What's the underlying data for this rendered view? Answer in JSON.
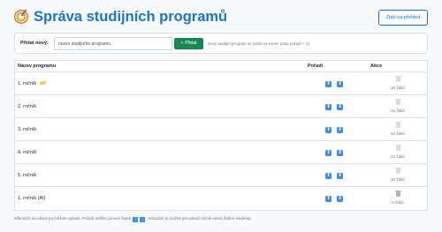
{
  "header": {
    "title": "Správa studijních programů",
    "back_label": "Zpět na přehled"
  },
  "add": {
    "label": "Přidat nový:",
    "input_value": "název studijního programu",
    "button_label": "Přidat",
    "hint": "Nový studijní program se přidá na konec (max pořadí + 1)."
  },
  "table": {
    "headers": {
      "name": "Název programu",
      "order": "Pořadí",
      "actions": "Akce"
    },
    "rows": [
      {
        "name": "1. ročník",
        "count": "30 žáků",
        "up": "⬆",
        "down": "⬇"
      },
      {
        "name": "2. ročník",
        "count": "31 žáků",
        "up": "⬆",
        "down": "⬇"
      },
      {
        "name": "3. ročník",
        "count": "40 žáků",
        "up": "⬆",
        "down": "⬇"
      },
      {
        "name": "4. ročník",
        "count": "31 žáků",
        "up": "⬆",
        "down": "⬇"
      },
      {
        "name": "5. ročník",
        "count": "30 žáků",
        "up": "⬆",
        "down": "⬇"
      },
      {
        "name": "1. ročník (AI)",
        "count": "0 žáků",
        "up": "⬆",
        "down": "⬇"
      }
    ]
  },
  "footer": {
    "part1": "Kliknutím na název jej můžete upravit. Pořadí měňte pomocí šipek",
    "part2": ". Smazání je možné jen pokud ročník nemá žádné studenty."
  },
  "colors": {
    "title": "#1976d2",
    "primary": "#0d6efd",
    "success": "#198754",
    "arrow": "#3d8bfd"
  },
  "icons": {
    "logo": "compass-icon",
    "add": "plus-icon",
    "edit": "pencil-icon",
    "up": "arrow-up-icon",
    "down": "arrow-down-icon",
    "delete": "trash-icon"
  }
}
